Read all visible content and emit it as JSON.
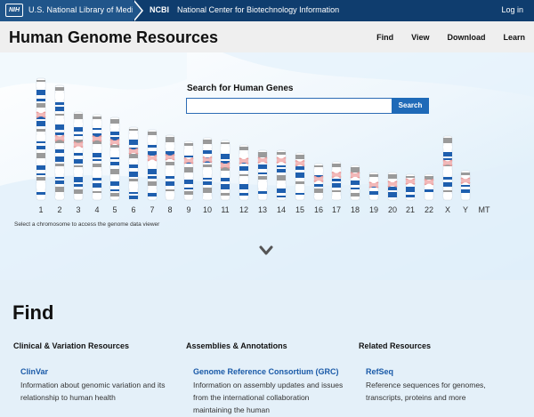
{
  "topbar": {
    "nih_badge": "NIH",
    "nlm": "U.S. National Library of Medicine",
    "ncbi_short": "NCBI",
    "ncbi_full": "National Center for Biotechnology Information",
    "login": "Log in"
  },
  "header": {
    "title": "Human Genome Resources",
    "nav": [
      "Find",
      "View",
      "Download",
      "Learn"
    ]
  },
  "hero": {
    "search_label": "Search for Human Genes",
    "search_value": "",
    "search_button": "Search",
    "chromosomes": [
      "1",
      "2",
      "3",
      "4",
      "5",
      "6",
      "7",
      "8",
      "9",
      "10",
      "11",
      "12",
      "13",
      "14",
      "15",
      "16",
      "17",
      "18",
      "19",
      "20",
      "21",
      "22",
      "X",
      "Y",
      "MT"
    ],
    "hint": "Select a chromosome to access the genome data viewer"
  },
  "find": {
    "title": "Find",
    "columns": [
      {
        "heading": "Clinical & Variation Resources",
        "link": "ClinVar",
        "description": "Information about genomic variation and its relationship to human health"
      },
      {
        "heading": "Assemblies & Annotations",
        "link": "Genome Reference Consortium (GRC)",
        "description": "Information on assembly updates and issues from the international collaboration maintaining the human"
      },
      {
        "heading": "Related Resources",
        "link": "RefSeq",
        "description": "Reference sequences for genomes, transcripts, proteins and more"
      }
    ]
  },
  "colors": {
    "topbar": "#20558a",
    "ncbi": "#0f3d6e",
    "band_dark": "#1f5fae",
    "band_gray": "#9a9a9a",
    "centromere": "#e89a9a",
    "link": "#1a5aa8",
    "find_bg": "#e4f0f9"
  },
  "icons": {
    "scroll_down": "chevron-down-icon"
  }
}
